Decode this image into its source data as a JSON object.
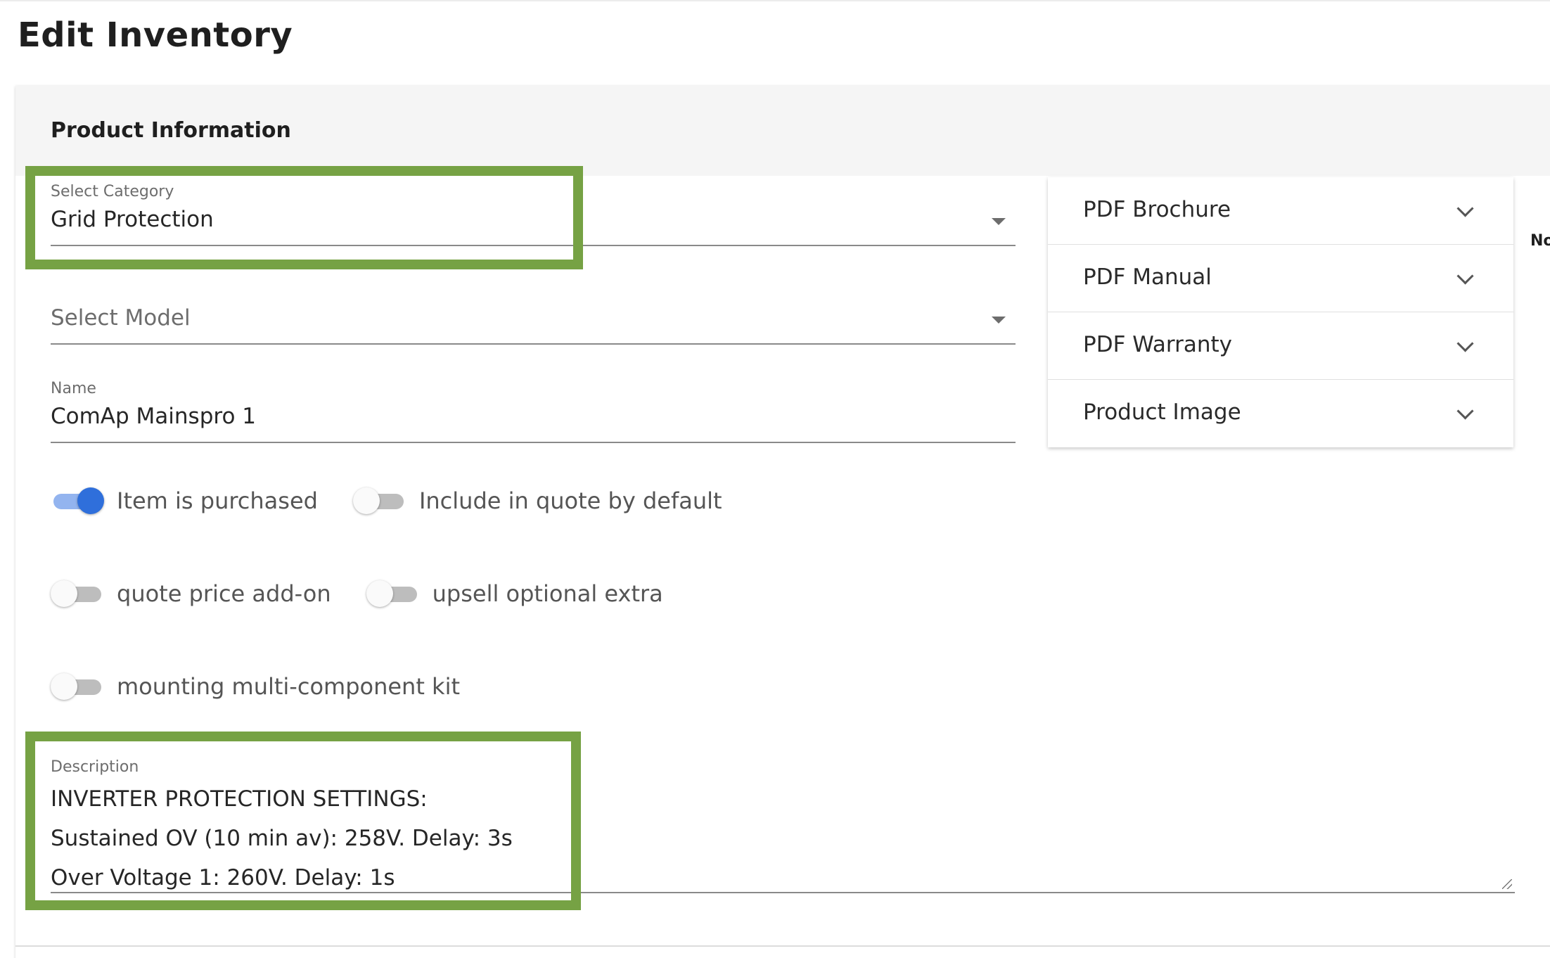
{
  "page": {
    "title": "Edit Inventory"
  },
  "card": {
    "title": "Product Information"
  },
  "form": {
    "category": {
      "label": "Select Category",
      "value": "Grid Protection"
    },
    "model": {
      "placeholder": "Select Model"
    },
    "name": {
      "label": "Name",
      "value": "ComAp Mainspro 1"
    },
    "toggles": [
      {
        "label": "Item is purchased",
        "on": true
      },
      {
        "label": "Include in quote by default",
        "on": false
      },
      {
        "label": "quote price add-on",
        "on": false
      },
      {
        "label": "upsell optional extra",
        "on": false
      },
      {
        "label": "mounting multi-component kit",
        "on": false
      }
    ],
    "description": {
      "label": "Description",
      "lines": [
        "INVERTER PROTECTION SETTINGS:",
        "Sustained OV (10 min av): 258V. Delay: 3s",
        "Over Voltage 1: 260V. Delay: 1s"
      ]
    }
  },
  "accordion": {
    "items": [
      {
        "label": "PDF Brochure"
      },
      {
        "label": "PDF Manual"
      },
      {
        "label": "PDF Warranty"
      },
      {
        "label": "Product Image"
      }
    ]
  },
  "cutoff": {
    "text": "No"
  },
  "colors": {
    "accent": "#2f6fdb",
    "highlight": "#76a244",
    "header_bg": "#f5f5f5"
  }
}
